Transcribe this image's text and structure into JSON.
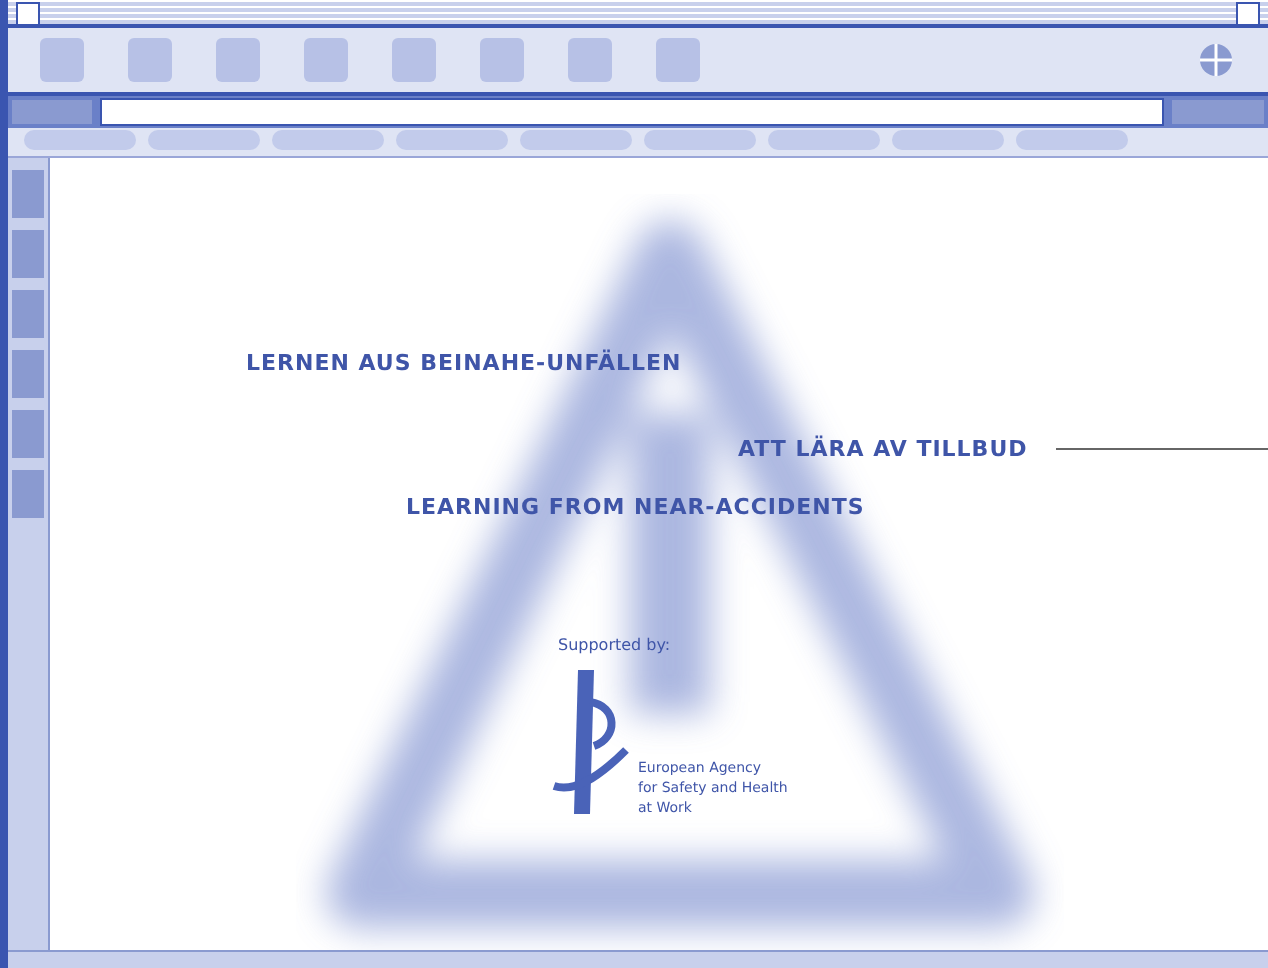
{
  "page": {
    "headings": [
      {
        "kind": "de",
        "text": "LERNEN AUS BEINAHE-UNFÄLLEN"
      },
      {
        "kind": "sv",
        "text": "ATT LÄRA AV TILLBUD"
      },
      {
        "kind": "en",
        "text": "LEARNING FROM NEAR-ACCIDENTS"
      }
    ],
    "supported_by": "Supported by:",
    "agency_lines": [
      "European Agency",
      "for Safety and Health",
      "at Work"
    ]
  }
}
